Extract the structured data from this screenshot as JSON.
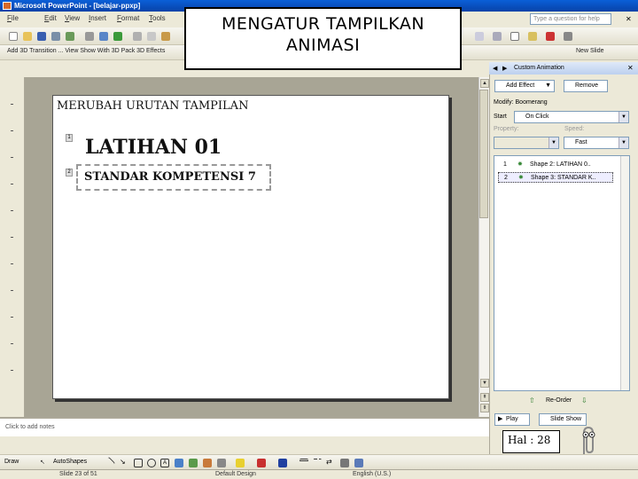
{
  "window": {
    "title": "Microsoft PowerPoint - [belajar-ppxp]"
  },
  "menu": {
    "items": [
      "File",
      "Edit",
      "View",
      "Insert",
      "Format",
      "Tools"
    ]
  },
  "help_box": {
    "placeholder": "Type a question for help"
  },
  "toolbar": {
    "format_text": "Add 3D Transition ...   View Show With 3D   Pack 3D Effects",
    "task_pane_right": "New Slide"
  },
  "overlay": {
    "title_line1": "MENGATUR TAMPILKAN",
    "title_line2": "ANIMASI"
  },
  "slide": {
    "heading": "MERUBAH URUTAN TAMPILAN",
    "title": "LATIHAN 01",
    "subtitle": "STANDAR KOMPETENSI 7",
    "order_tags": [
      "1",
      "2"
    ]
  },
  "notes": {
    "placeholder": "Click to add notes"
  },
  "task_pane": {
    "title": "Custom Animation",
    "add_effect": "Add Effect",
    "remove": "Remove",
    "modify_label": "Modify: Boomerang",
    "start_label": "Start",
    "start_value": "On Click",
    "property_label": "Property:",
    "speed_label": "Speed:",
    "speed_value": "Fast",
    "items": [
      {
        "order": "1",
        "label": "Shape 2: LATIHAN 0.."
      },
      {
        "order": "2",
        "label": "Shape 3: STANDAR K.."
      }
    ],
    "reorder": "Re-Order",
    "play": "Play",
    "slide_show": "Slide Show"
  },
  "page_label": "Hal : 28",
  "drawbar": {
    "draw": "Draw",
    "autoshapes": "AutoShapes"
  },
  "status": {
    "slide": "Slide 23 of 51",
    "design": "Default Design",
    "language": "English (U.S.)"
  }
}
